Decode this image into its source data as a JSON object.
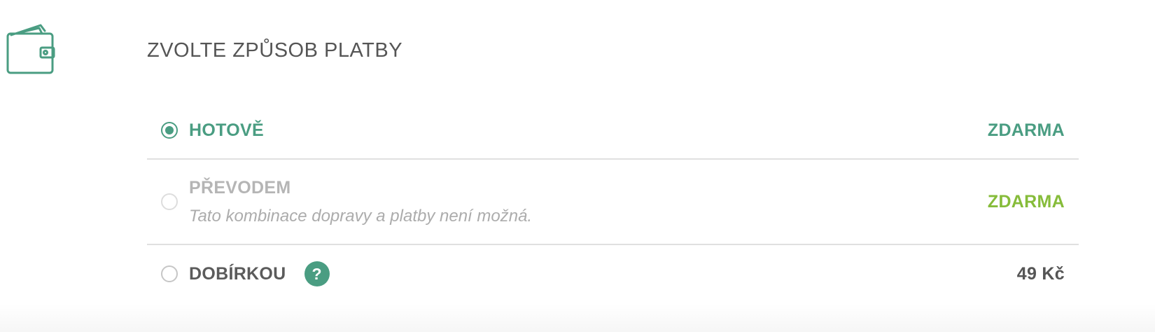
{
  "icons": {
    "wallet": "wallet-icon",
    "help": "question-mark-icon"
  },
  "colors": {
    "accent": "#4a9d82",
    "free_price_alt": "#86bc3a",
    "disabled_text": "#b5b5b5"
  },
  "section": {
    "title": "ZVOLTE ZPŮSOB PLATBY"
  },
  "payment_options": [
    {
      "label": "HOTOVĚ",
      "price": "ZDARMA",
      "selected": true,
      "disabled": false
    },
    {
      "label": "PŘEVODEM",
      "note": "Tato kombinace dopravy a platby není možná.",
      "price": "ZDARMA",
      "selected": false,
      "disabled": true
    },
    {
      "label": "DOBÍRKOU",
      "help": "?",
      "price": "49 Kč",
      "selected": false,
      "disabled": false
    }
  ]
}
